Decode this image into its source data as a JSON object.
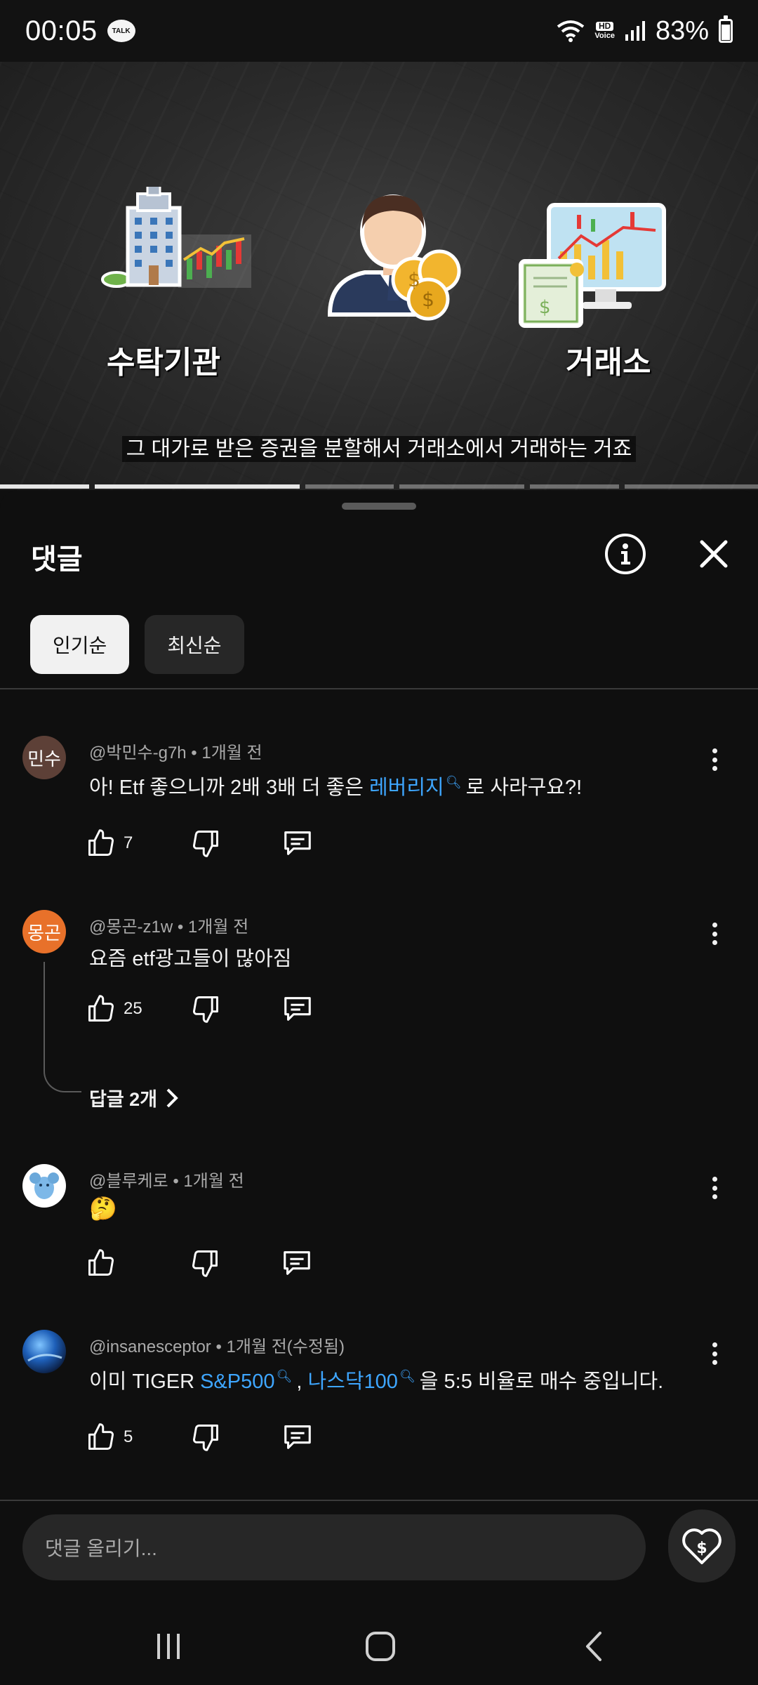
{
  "status_bar": {
    "time": "00:05",
    "talk_badge": "TALK",
    "hd_label": "HD",
    "voice_label": "Voice",
    "battery": "83%"
  },
  "video": {
    "label_left": "수탁기관",
    "label_right": "거래소",
    "subtitle": "그 대가로 받은 증권을 분할해서 거래소에서 거래하는 거죠"
  },
  "sheet": {
    "title": "댓글",
    "chips": [
      "인기순",
      "최신순"
    ]
  },
  "comments": [
    {
      "avatar_text": "민수",
      "avatar_color": "#5d4037",
      "meta": "@박민수-g7h • 1개월 전",
      "text_before": "아! Etf 좋으니까 2배 3배 더 좋은 ",
      "link1": "레버리지",
      "text_after": "로 사라구요?!",
      "likes": "7"
    },
    {
      "avatar_text": "몽곤",
      "avatar_color": "#e8712a",
      "meta": "@몽곤-z1w • 1개월 전",
      "text": "요즘 etf광고들이 많아짐",
      "likes": "25",
      "replies_label": "답글 2개"
    },
    {
      "meta": "@블루케로 • 1개월 전",
      "text": "🤔",
      "likes": ""
    },
    {
      "meta": "@insanesceptor • 1개월 전(수정됨)",
      "text_before": "이미 TIGER ",
      "link1": "S&P500",
      "sep": ", ",
      "link2": "나스닥100",
      "text_after": "을 5:5 비율로 매수 중입니다.",
      "likes": "5"
    }
  ],
  "composer": {
    "placeholder": "댓글 올리기..."
  },
  "colors": {
    "link": "#3ea6ff",
    "background": "#0f0f0f"
  }
}
